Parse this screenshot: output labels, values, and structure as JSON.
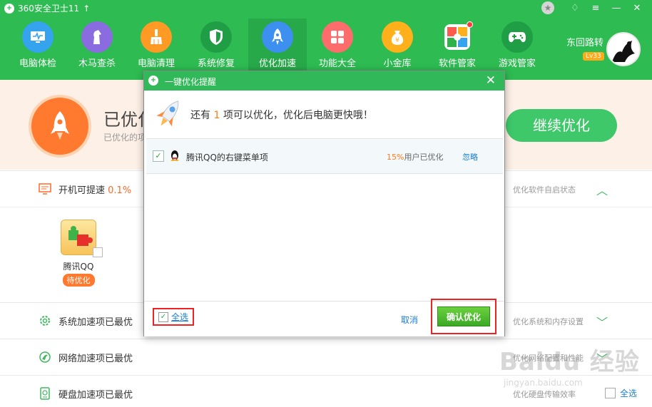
{
  "app": {
    "title": "360安全卫士11",
    "logo_glyph": "+",
    "up_glyph": "↑"
  },
  "window": {
    "star": "★",
    "skin": "♢",
    "menu": "≡",
    "minimize": "—",
    "close": "✕"
  },
  "nav": [
    {
      "label": "电脑体检",
      "icon": "monitor-icon",
      "color": "#36a3ee"
    },
    {
      "label": "木马查杀",
      "icon": "horse-icon",
      "color": "#8b6be0"
    },
    {
      "label": "电脑清理",
      "icon": "broom-icon",
      "color": "#ff9a24"
    },
    {
      "label": "系统修复",
      "icon": "shield-icon",
      "color": "#1f9e45"
    },
    {
      "label": "优化加速",
      "icon": "rocket-icon",
      "color": "#3d8ff0"
    },
    {
      "label": "功能大全",
      "icon": "grid-icon",
      "color": "#ff6c6c"
    },
    {
      "label": "小金库",
      "icon": "coin-bag-icon",
      "color": "#ffb01a"
    },
    {
      "label": "软件管家",
      "icon": "software-icon",
      "color": "#ff7a3d"
    },
    {
      "label": "游戏管家",
      "icon": "gamepad-icon",
      "color": "#2fb14a"
    }
  ],
  "user": {
    "name": "东回路转",
    "level": "Lv33"
  },
  "summary": {
    "title": "已优化",
    "subtitle": "已优化的项",
    "continue_label": "继续优化"
  },
  "startup": {
    "label": "开机可提速",
    "value": "0.1%",
    "right": "优化软件自启状态",
    "chevron": "︿"
  },
  "qq_card": {
    "name": "腾讯QQ",
    "status": "待优化"
  },
  "rows": [
    {
      "label": "系统加速项已最优",
      "right": "优化系统和内存设置",
      "chevron": "﹀"
    },
    {
      "label": "网络加速项已最优",
      "right": "优化网络配置和性能",
      "chevron": "﹀"
    },
    {
      "label": "硬盘加速项已最优",
      "right": "优化硬盘传输效率",
      "chevron": "﹀"
    }
  ],
  "select_all_bottom": "全选",
  "watermark": {
    "main": "Baidu 经验",
    "sub": "jingyan.baidu.com"
  },
  "dialog": {
    "title": "一键优化提醒",
    "close": "✕",
    "message_pre": "还有",
    "message_count": "1",
    "message_post": "项可以优化，优化后电脑更快哦！",
    "item": {
      "name": "腾讯QQ的右键菜单项",
      "percent": "15%",
      "percent_suffix": "用户已优化",
      "ignore": "忽略",
      "check": "✓"
    },
    "select_all": "全选",
    "cancel": "取消",
    "confirm": "确认优化"
  }
}
